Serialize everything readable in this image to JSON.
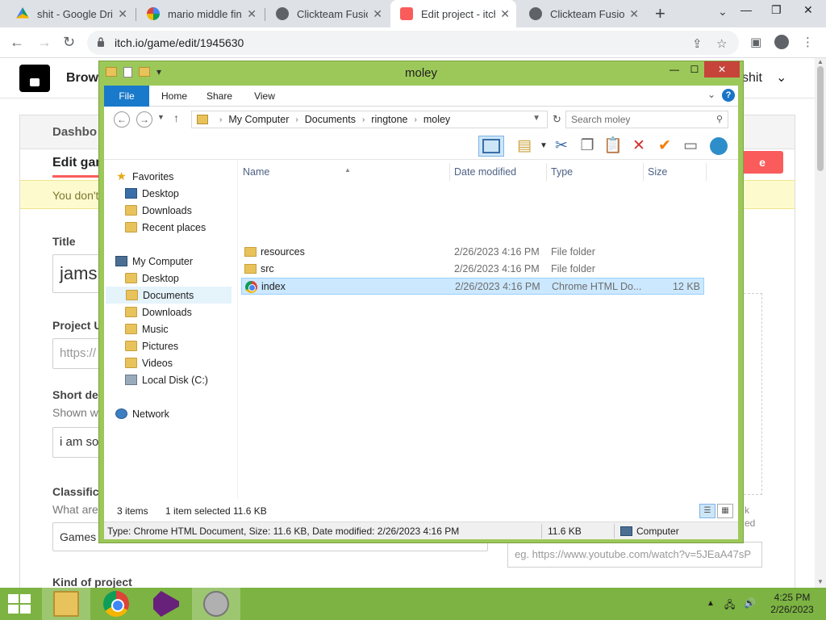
{
  "browser": {
    "tabs": [
      {
        "label": "shit - Google Drive",
        "icon": "google-drive-icon"
      },
      {
        "label": "mario middle finger",
        "icon": "google-icon"
      },
      {
        "label": "Clickteam Fusion",
        "icon": "globe-icon"
      },
      {
        "label": "Edit project - itch.io",
        "icon": "itchio-icon"
      },
      {
        "label": "Clickteam Fusion",
        "icon": "globe-icon"
      }
    ],
    "active_tab": 3,
    "url": "itch.io/game/edit/1945630"
  },
  "itch_page": {
    "browse": "Brows",
    "user": "shit",
    "dashboard": "Dashbo",
    "edit_tab": "Edit gam",
    "red_button": "e",
    "notice": "You don't",
    "title_label": "Title",
    "title_value": "jams",
    "project_url_label": "Project U",
    "project_url_value": "https://",
    "short_desc_label": "Short des",
    "short_desc_sub": "Shown wh",
    "short_desc_value": "i am so",
    "classification_label": "Classifica",
    "classification_sub": "What are",
    "classification_value": "Games –",
    "kind_label": "Kind of project",
    "side_note_1": "k",
    "side_note_2": "ed",
    "video_placeholder": "eg. https://www.youtube.com/watch?v=5JEaA47sP"
  },
  "explorer": {
    "title": "moley",
    "ribbon_tabs": [
      "File",
      "Home",
      "Share",
      "View"
    ],
    "breadcrumb": [
      "My Computer",
      "Documents",
      "ringtone",
      "moley"
    ],
    "search_placeholder": "Search moley",
    "nav": {
      "favorites": "Favorites",
      "favorites_items": [
        "Desktop",
        "Downloads",
        "Recent places"
      ],
      "computer": "My Computer",
      "computer_items": [
        "Desktop",
        "Documents",
        "Downloads",
        "Music",
        "Pictures",
        "Videos",
        "Local Disk (C:)"
      ],
      "network": "Network"
    },
    "columns": [
      "Name",
      "Date modified",
      "Type",
      "Size"
    ],
    "files": [
      {
        "name": "resources",
        "date": "2/26/2023 4:16 PM",
        "type": "File folder",
        "size": ""
      },
      {
        "name": "src",
        "date": "2/26/2023 4:16 PM",
        "type": "File folder",
        "size": ""
      },
      {
        "name": "index",
        "date": "2/26/2023 4:16 PM",
        "type": "Chrome HTML Do...",
        "size": "12 KB"
      }
    ],
    "status": {
      "count": "3 items",
      "selected": "1 item selected",
      "selected_size": "11.6 KB"
    },
    "details_bar": {
      "text": "Type: Chrome HTML Document, Size: 11.6 KB, Date modified: 2/26/2023 4:16 PM",
      "size": "11.6 KB",
      "location": "Computer"
    }
  },
  "taskbar": {
    "time": "4:25 PM",
    "date": "2/26/2023"
  }
}
